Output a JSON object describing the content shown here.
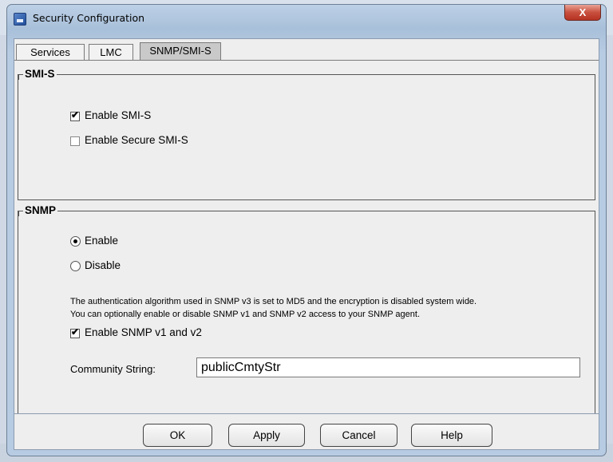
{
  "window": {
    "title": "Security Configuration",
    "close_label": "X"
  },
  "tabs": [
    {
      "label": "Services"
    },
    {
      "label": "LMC"
    },
    {
      "label": "SNMP/SMI-S"
    }
  ],
  "smis": {
    "title": "SMI-S",
    "enable_label": "Enable SMI-S",
    "enable_checked": true,
    "secure_label": "Enable Secure SMI-S",
    "secure_checked": false
  },
  "snmp": {
    "title": "SNMP",
    "radio_enable_label": "Enable",
    "radio_disable_label": "Disable",
    "selected": "Enable",
    "info_line1": "The authentication algorithm used in SNMP v3 is set to MD5 and the encryption is disabled system wide.",
    "info_line2": "You can optionally enable or disable SNMP v1 and SNMP v2 access to your SNMP agent.",
    "v1v2_label": "Enable SNMP v1 and v2",
    "v1v2_checked": true,
    "community_label": "Community String:",
    "community_value": "publicCmtyStr"
  },
  "buttons": {
    "ok": "OK",
    "apply": "Apply",
    "cancel": "Cancel",
    "help": "Help"
  }
}
